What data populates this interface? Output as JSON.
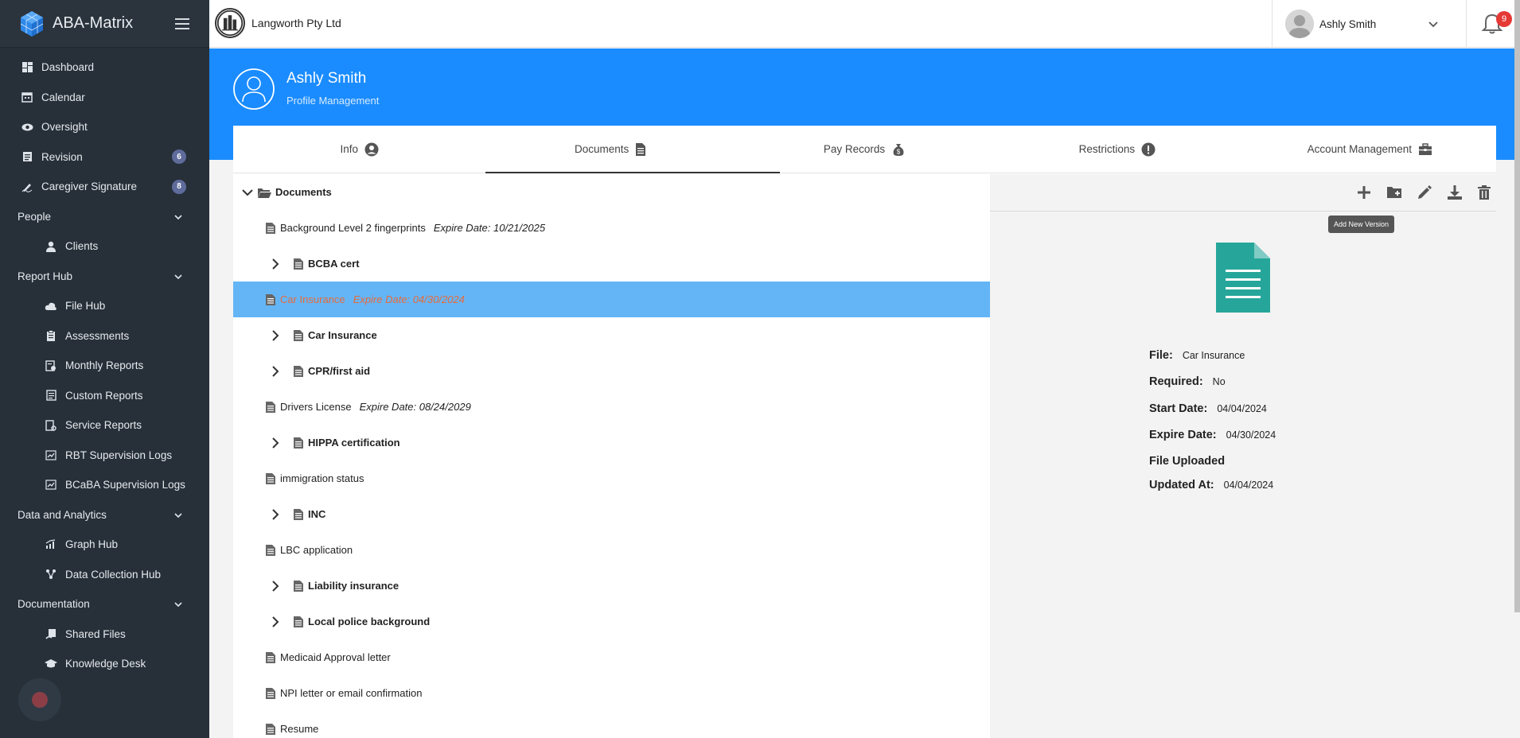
{
  "app": {
    "name": "ABA-Matrix"
  },
  "sidebar": {
    "items": [
      {
        "label": "Dashboard",
        "icon": "dashboard-icon"
      },
      {
        "label": "Calendar",
        "icon": "calendar-icon"
      },
      {
        "label": "Oversight",
        "icon": "eye-icon"
      },
      {
        "label": "Revision",
        "icon": "revision-icon",
        "badge": "6"
      },
      {
        "label": "Caregiver Signature",
        "icon": "signature-icon",
        "badge": "8"
      }
    ],
    "sections": [
      {
        "label": "People",
        "items": [
          {
            "label": "Clients",
            "icon": "person-icon"
          }
        ]
      },
      {
        "label": "Report Hub",
        "items": [
          {
            "label": "File Hub",
            "icon": "cloud-icon"
          },
          {
            "label": "Assessments",
            "icon": "clipboard-icon"
          },
          {
            "label": "Monthly Reports",
            "icon": "report-icon"
          },
          {
            "label": "Custom Reports",
            "icon": "custom-report-icon"
          },
          {
            "label": "Service Reports",
            "icon": "service-report-icon"
          },
          {
            "label": "RBT Supervision Logs",
            "icon": "chart-log-icon"
          },
          {
            "label": "BCaBA Supervision Logs",
            "icon": "chart-log-icon"
          }
        ]
      },
      {
        "label": "Data and Analytics",
        "items": [
          {
            "label": "Graph Hub",
            "icon": "graph-icon"
          },
          {
            "label": "Data Collection Hub",
            "icon": "data-collection-icon"
          }
        ]
      },
      {
        "label": "Documentation",
        "items": [
          {
            "label": "Shared Files",
            "icon": "shared-files-icon"
          },
          {
            "label": "Knowledge Desk",
            "icon": "graduation-icon"
          }
        ]
      }
    ]
  },
  "topbar": {
    "company": "Langworth Pty Ltd",
    "user": "Ashly Smith",
    "notifications": "9"
  },
  "banner": {
    "name": "Ashly Smith",
    "subtitle": "Profile Management"
  },
  "tabs": [
    {
      "label": "Info",
      "icon": "user-circle-icon"
    },
    {
      "label": "Documents",
      "icon": "document-icon"
    },
    {
      "label": "Pay Records",
      "icon": "money-bag-icon"
    },
    {
      "label": "Restrictions",
      "icon": "exclamation-icon"
    },
    {
      "label": "Account Management",
      "icon": "briefcase-icon"
    }
  ],
  "tree": {
    "root": "Documents",
    "rows": [
      {
        "type": "file",
        "label": "Background Level 2 fingerprints",
        "expire": "Expire Date: 10/21/2025"
      },
      {
        "type": "folder",
        "label": "BCBA cert"
      },
      {
        "type": "file",
        "label": "Car Insurance",
        "expire": "Expire Date: 04/30/2024",
        "selected": true
      },
      {
        "type": "folder",
        "label": "Car Insurance"
      },
      {
        "type": "folder",
        "label": "CPR/first aid"
      },
      {
        "type": "file",
        "label": "Drivers License",
        "expire": "Expire Date: 08/24/2029"
      },
      {
        "type": "folder",
        "label": "HIPPA certification"
      },
      {
        "type": "file",
        "label": "immigration status",
        "expire": ""
      },
      {
        "type": "folder",
        "label": "INC"
      },
      {
        "type": "file",
        "label": "LBC application",
        "expire": ""
      },
      {
        "type": "folder",
        "label": "Liability insurance"
      },
      {
        "type": "folder",
        "label": "Local police background"
      },
      {
        "type": "file",
        "label": "Medicaid Approval letter",
        "expire": ""
      },
      {
        "type": "file",
        "label": "NPI letter or email confirmation",
        "expire": ""
      },
      {
        "type": "file",
        "label": "Resume",
        "expire": ""
      }
    ]
  },
  "panel": {
    "tooltip": "Add New Version",
    "details": {
      "file_label": "File:",
      "file_value": "Car Insurance",
      "required_label": "Required:",
      "required_value": "No",
      "start_label": "Start Date:",
      "start_value": "04/04/2024",
      "expire_label": "Expire Date:",
      "expire_value": "04/30/2024",
      "uploaded_label": "File Uploaded",
      "updated_label": "Updated At:",
      "updated_value": "04/04/2024"
    }
  },
  "colors": {
    "accent": "#1a8cff",
    "sidebar": "#273039",
    "selected_row": "#64b5f6",
    "doc_icon": "#26a69a"
  }
}
